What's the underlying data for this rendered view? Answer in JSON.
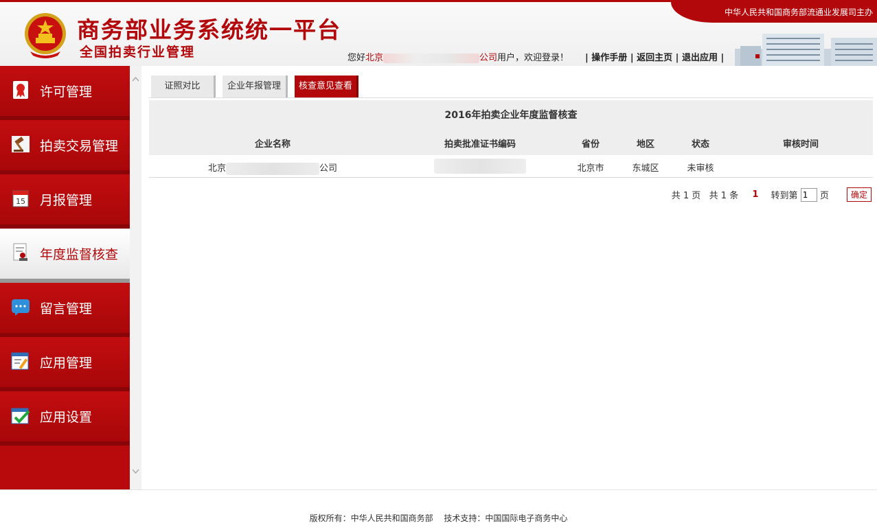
{
  "header": {
    "title": "商务部业务系统统一平台",
    "subtitle": "全国拍卖行业管理",
    "banner": "中华人民共和国商务部流通业发展司主办",
    "welcome_prefix": "您好",
    "welcome_org_start": "北京",
    "welcome_org_end": "公司",
    "welcome_suffix": "用户，欢迎登录！",
    "links": [
      "操作手册",
      "返回主页",
      "退出应用"
    ],
    "accent_color": "#b3080b"
  },
  "sidebar": {
    "items": [
      {
        "label": "许可管理",
        "icon": "award-ribbon-icon"
      },
      {
        "label": "拍卖交易管理",
        "icon": "gavel-icon"
      },
      {
        "label": "月报管理",
        "icon": "calendar-icon",
        "icon_text": "15"
      },
      {
        "label": "年度监督核查",
        "icon": "document-stamp-icon",
        "active": true
      },
      {
        "label": "留言管理",
        "icon": "chat-bubble-icon"
      },
      {
        "label": "应用管理",
        "icon": "app-window-edit-icon"
      },
      {
        "label": "应用设置",
        "icon": "checklist-icon"
      }
    ]
  },
  "tabs": [
    {
      "label": "证照对比"
    },
    {
      "label": "企业年报管理"
    },
    {
      "label": "核查意见查看",
      "active": true
    }
  ],
  "table": {
    "title": "2016年拍卖企业年度监督核查",
    "columns": [
      "企业名称",
      "拍卖批准证书编码",
      "省份",
      "地区",
      "状态",
      "审核时间"
    ],
    "rows": [
      {
        "name_start": "北京",
        "name_end": "公司",
        "cert": "",
        "province": "北京市",
        "district": "东城区",
        "status": "未审核",
        "time": ""
      }
    ]
  },
  "pager": {
    "total_pages": "共 1 页",
    "total_items": "共 1 条",
    "current": "1",
    "goto_label": "转到第",
    "goto_value": "1",
    "page_unit": "页",
    "confirm": "确定"
  },
  "footer": {
    "text": "版权所有：中华人民共和国商务部　 技术支持：中国国际电子商务中心"
  }
}
